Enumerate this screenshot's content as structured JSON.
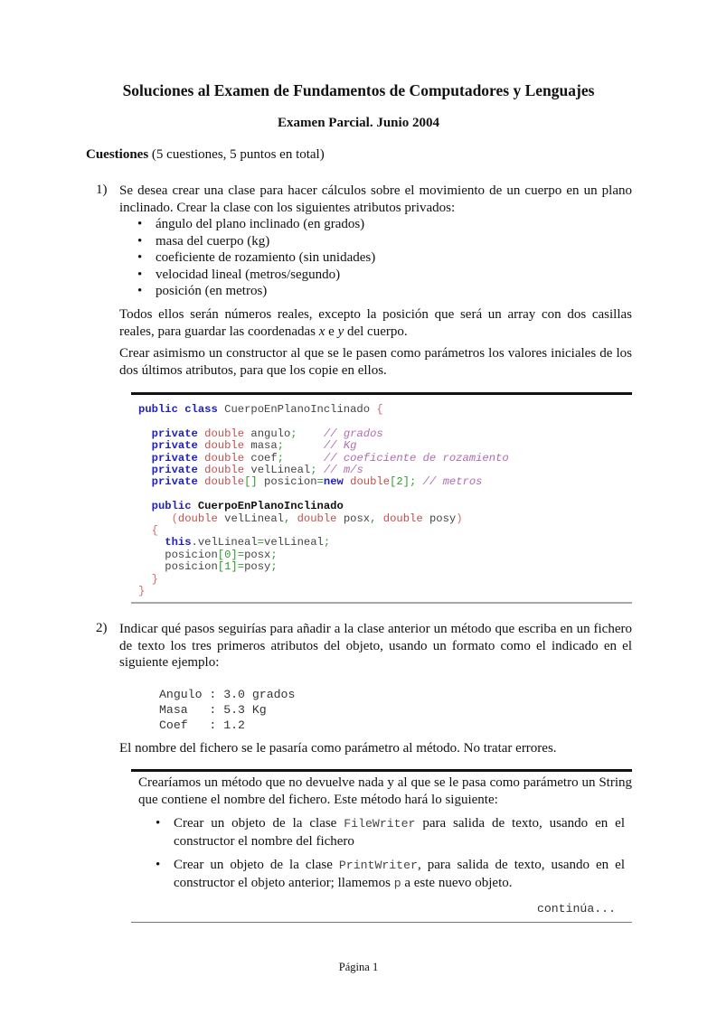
{
  "document": {
    "title": "Soluciones al Examen de Fundamentos de Computadores y Lenguajes",
    "subtitle": "Examen Parcial. Junio 2004",
    "section": {
      "heading": "Cuestiones",
      "note": " (5 cuestiones, 5 puntos en total)"
    },
    "q1": {
      "number": "1)",
      "intro": "Se desea crear una clase para hacer cálculos sobre el movimiento de un cuerpo en un plano inclinado. Crear la clase con los siguientes atributos privados:",
      "bullet_glyph": "•",
      "attributes": [
        "ángulo del plano inclinado (en grados)",
        "masa del cuerpo (kg)",
        "coeficiente de rozamiento (sin unidades)",
        "velocidad lineal (metros/segundo)",
        "posición (en metros)"
      ],
      "para2_a": "Todos ellos serán números reales, excepto la posición que será un array con dos casillas reales, para guardar las coordenadas ",
      "para2_x": "x",
      "para2_e": " e ",
      "para2_y": "y",
      "para2_b": " del cuerpo.",
      "para3": "Crear asimismo un constructor al que se le pasen como parámetros los valores iniciales de los dos últimos atributos, para que los copie en ellos."
    },
    "code": {
      "l1_kw1": "public",
      "l1_kw2": "class",
      "l1_name": "CuerpoEnPlanoInclinado",
      "l1_brace": "{",
      "private": "private",
      "double": "double",
      "fields": [
        {
          "name": "angulo",
          "semi": ";",
          "pad": "    ",
          "comment": "// grados"
        },
        {
          "name": "masa",
          "semi": ";",
          "pad": "      ",
          "comment": "// Kg"
        },
        {
          "name": "coef",
          "semi": ";",
          "pad": "      ",
          "comment": "// coeficiente de rozamiento"
        },
        {
          "name": "velLineal",
          "semi": ";",
          "pad": " ",
          "comment": "// m/s"
        }
      ],
      "pos_brackets": "[]",
      "pos_name": "posicion",
      "pos_eq": "=",
      "pos_new": "new",
      "pos_size": "[2]",
      "pos_semi": ";",
      "pos_comment": "// metros",
      "ctor_kw": "public",
      "ctor_name": "CuerpoEnPlanoInclinado",
      "ctor_open": "(",
      "ctor_p1": "velLineal",
      "comma": ",",
      "ctor_p2": "posx",
      "ctor_p3": "posy",
      "ctor_close": ")",
      "open_brace": "{",
      "close_brace": "}",
      "this_kw": "this",
      "this_rest": ".velLineal",
      "eq": "=",
      "this_val": "velLineal",
      "semi": ";",
      "pos0_a": "posicion",
      "pos0_idx": "[0]",
      "pos0_val": "posx",
      "pos1_a": "posicion",
      "pos1_idx": "[1]",
      "pos1_val": "posy"
    },
    "q2": {
      "number": "2)",
      "intro": "Indicar qué pasos seguirías para añadir a la clase anterior un método que escriba en un fichero de texto los tres primeros atributos del objeto, usando un formato como el indicado en el siguiente ejemplo:",
      "example_lines": [
        "Angulo : 3.0 grados",
        "Masa   : 5.3 Kg",
        "Coef   : 1.2"
      ],
      "note": "El nombre del fichero se le pasaría como parámetro al método. No tratar errores."
    },
    "answer2": {
      "intro": "Crearíamos un método que no devuelve nada y al que se le pasa como parámetro un String que contiene el nombre del fichero. Este método hará lo siguiente:",
      "steps": [
        {
          "a": "Crear un objeto de la clase ",
          "code": "FileWriter",
          "b": " para salida de texto, usando en el constructor el nombre del fichero"
        },
        {
          "a": "Crear un objeto de la clase ",
          "code": "PrintWriter",
          "b": ", para salida de texto, usando en el constructor el objeto anterior; llamemos ",
          "code2": "p",
          "c": " a este nuevo objeto."
        }
      ],
      "continues": "continúa..."
    },
    "footer": {
      "page": "Página 1"
    }
  }
}
